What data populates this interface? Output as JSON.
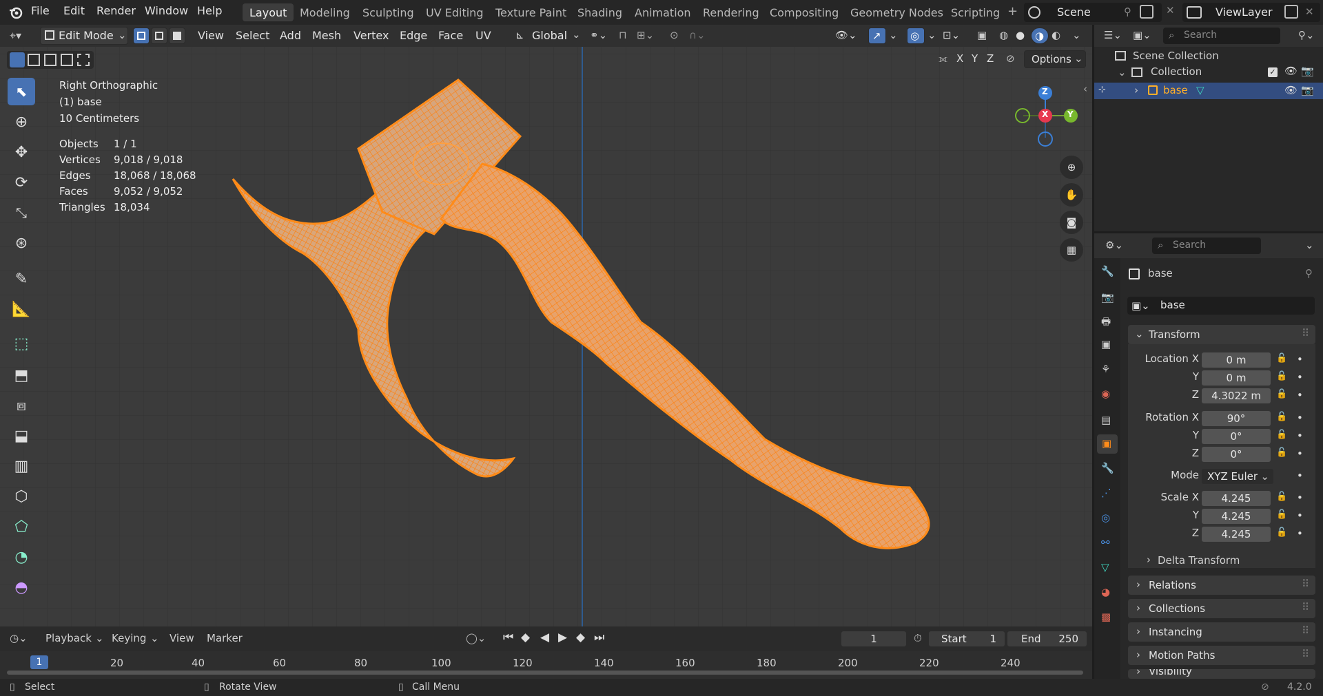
{
  "app": {
    "version": "4.2.0"
  },
  "menu": [
    "File",
    "Edit",
    "Render",
    "Window",
    "Help"
  ],
  "workspaces": [
    "Layout",
    "Modeling",
    "Sculpting",
    "UV Editing",
    "Texture Paint",
    "Shading",
    "Animation",
    "Rendering",
    "Compositing",
    "Geometry Nodes",
    "Scripting"
  ],
  "scene": {
    "name": "Scene",
    "view_layer": "ViewLayer"
  },
  "viewport_header": {
    "mode": "Edit Mode",
    "menus": [
      "View",
      "Select",
      "Add",
      "Mesh",
      "Vertex",
      "Edge",
      "Face",
      "UV"
    ],
    "orientation": "Global",
    "options_label": "Options",
    "axes": [
      "X",
      "Y",
      "Z"
    ]
  },
  "viewport_info": {
    "view_name": "Right Orthographic",
    "object_line": "(1) base",
    "scale_line": "10 Centimeters",
    "stats": [
      {
        "label": "Objects",
        "value": "1 / 1"
      },
      {
        "label": "Vertices",
        "value": "9,018 / 9,018"
      },
      {
        "label": "Edges",
        "value": "18,068 / 18,068"
      },
      {
        "label": "Faces",
        "value": "9,052 / 9,052"
      },
      {
        "label": "Triangles",
        "value": "18,034"
      }
    ]
  },
  "gizmo": {
    "z": "Z",
    "x": "X",
    "y": "Y"
  },
  "timeline": {
    "menus": [
      "Playback",
      "Keying",
      "View",
      "Marker"
    ],
    "current_frame": "1",
    "start_label": "Start",
    "start": "1",
    "end_label": "End",
    "end": "250",
    "ticks": [
      "20",
      "40",
      "60",
      "80",
      "100",
      "120",
      "140",
      "160",
      "180",
      "200",
      "220",
      "240"
    ]
  },
  "status": {
    "select": "Select",
    "rotate": "Rotate View",
    "menu": "Call Menu"
  },
  "outliner": {
    "search_placeholder": "Search",
    "scene_collection": "Scene Collection",
    "collection": "Collection",
    "object": "base"
  },
  "properties": {
    "search_placeholder": "Search",
    "object_name": "base",
    "name_field": "base",
    "transform_title": "Transform",
    "location_label": "Location X",
    "loc_x": "0 m",
    "loc_y": "0 m",
    "loc_z": "4.3022 m",
    "rotation_label": "Rotation X",
    "rot_x": "90°",
    "rot_y": "0°",
    "rot_z": "0°",
    "mode_label": "Mode",
    "mode": "XYZ Euler",
    "scale_label": "Scale X",
    "scale_x": "4.245",
    "scale_y": "4.245",
    "scale_z": "4.245",
    "y_label": "Y",
    "z_label": "Z",
    "sections": [
      "Delta Transform",
      "Relations",
      "Collections",
      "Instancing",
      "Motion Paths",
      "Visibility"
    ]
  },
  "colors": {
    "accent": "#4772b3",
    "mesh": "#ff8c1a",
    "active_object": "#ffaf29"
  }
}
